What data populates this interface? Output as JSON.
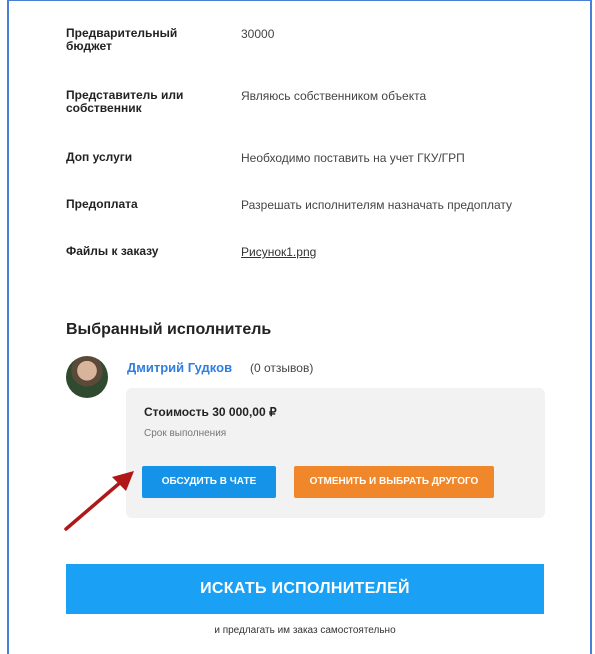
{
  "details": [
    {
      "label": "Предварительный бюджет",
      "value": "30000"
    },
    {
      "label": "Представитель или собственник",
      "value": "Являюсь собственником объекта"
    },
    {
      "label": "Доп услуги",
      "value": "Необходимо поставить на учет ГКУ/ГРП"
    },
    {
      "label": "Предоплата",
      "value": "Разрешать исполнителям назначать предоплату"
    },
    {
      "label": "Файлы к заказу",
      "value": "Рисунок1.png"
    }
  ],
  "selected": {
    "title": "Выбранный исполнитель",
    "name": "Дмитрий Гудков",
    "reviews": "(0 отзывов)",
    "price": "Стоимость 30 000,00 ₽",
    "term": "Срок выполнения",
    "chat_button": "ОБСУДИТЬ В ЧАТЕ",
    "cancel_button": "ОТМЕНИТЬ И ВЫБРАТЬ ДРУГОГО"
  },
  "search": {
    "button": "ИСКАТЬ ИСПОЛНИТЕЛЕЙ",
    "hint": "и предлагать им заказ самостоятельно"
  },
  "colors": {
    "link": "#2f7fe0",
    "chat_button": "#1593e8",
    "cancel_button": "#f0872a",
    "search_button": "#1aa0f5",
    "arrow": "#b01818"
  }
}
